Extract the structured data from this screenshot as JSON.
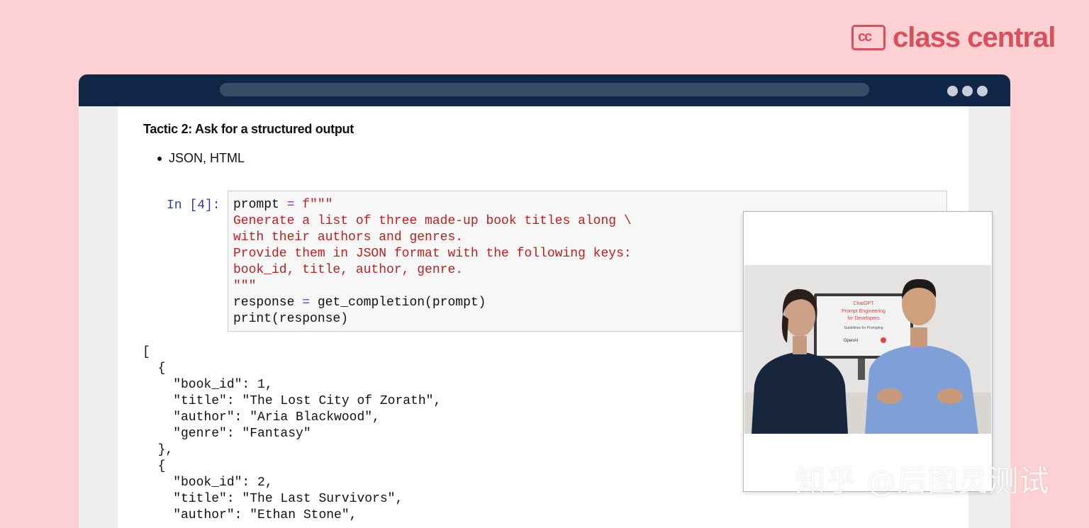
{
  "brand": {
    "logo_mark": "cc",
    "name": "class central",
    "color": "#d9505a"
  },
  "window": {
    "titlebar_color": "#0f2646"
  },
  "notebook": {
    "heading": "Tactic 2: Ask for a structured output",
    "bullets": [
      "JSON, HTML"
    ],
    "cell": {
      "prompt_label": "In [4]:",
      "lines": [
        [
          {
            "t": "prompt ",
            "c": "kw"
          },
          {
            "t": "=",
            "c": "op"
          },
          {
            "t": " f\"\"\"",
            "c": "str"
          }
        ],
        [
          {
            "t": "Generate a list of three made-up book titles along \\",
            "c": "str"
          }
        ],
        [
          {
            "t": "with their authors and genres.",
            "c": "str"
          }
        ],
        [
          {
            "t": "Provide them in JSON format with the following keys:",
            "c": "str"
          }
        ],
        [
          {
            "t": "book_id, title, author, genre.",
            "c": "str"
          }
        ],
        [
          {
            "t": "\"\"\"",
            "c": "str"
          }
        ],
        [
          {
            "t": "response ",
            "c": "kw"
          },
          {
            "t": "=",
            "c": "op"
          },
          {
            "t": " get_completion(prompt)",
            "c": "kw"
          }
        ],
        [
          {
            "t": "print(response)",
            "c": "kw"
          }
        ]
      ]
    },
    "output_lines": [
      "[",
      "  {",
      "    \"book_id\": 1,",
      "    \"title\": \"The Lost City of Zorath\",",
      "    \"author\": \"Aria Blackwood\",",
      "    \"genre\": \"Fantasy\"",
      "  },",
      "  {",
      "    \"book_id\": 2,",
      "    \"title\": \"The Last Survivors\",",
      "    \"author\": \"Ethan Stone\","
    ]
  },
  "video": {
    "screen_lines": [
      "ChatGPT",
      "Prompt Engineering",
      "for Developers",
      "Guidelines for Prompting"
    ],
    "screen_logo": "OpenAI"
  },
  "watermark": "知乎 @后图灵测试"
}
